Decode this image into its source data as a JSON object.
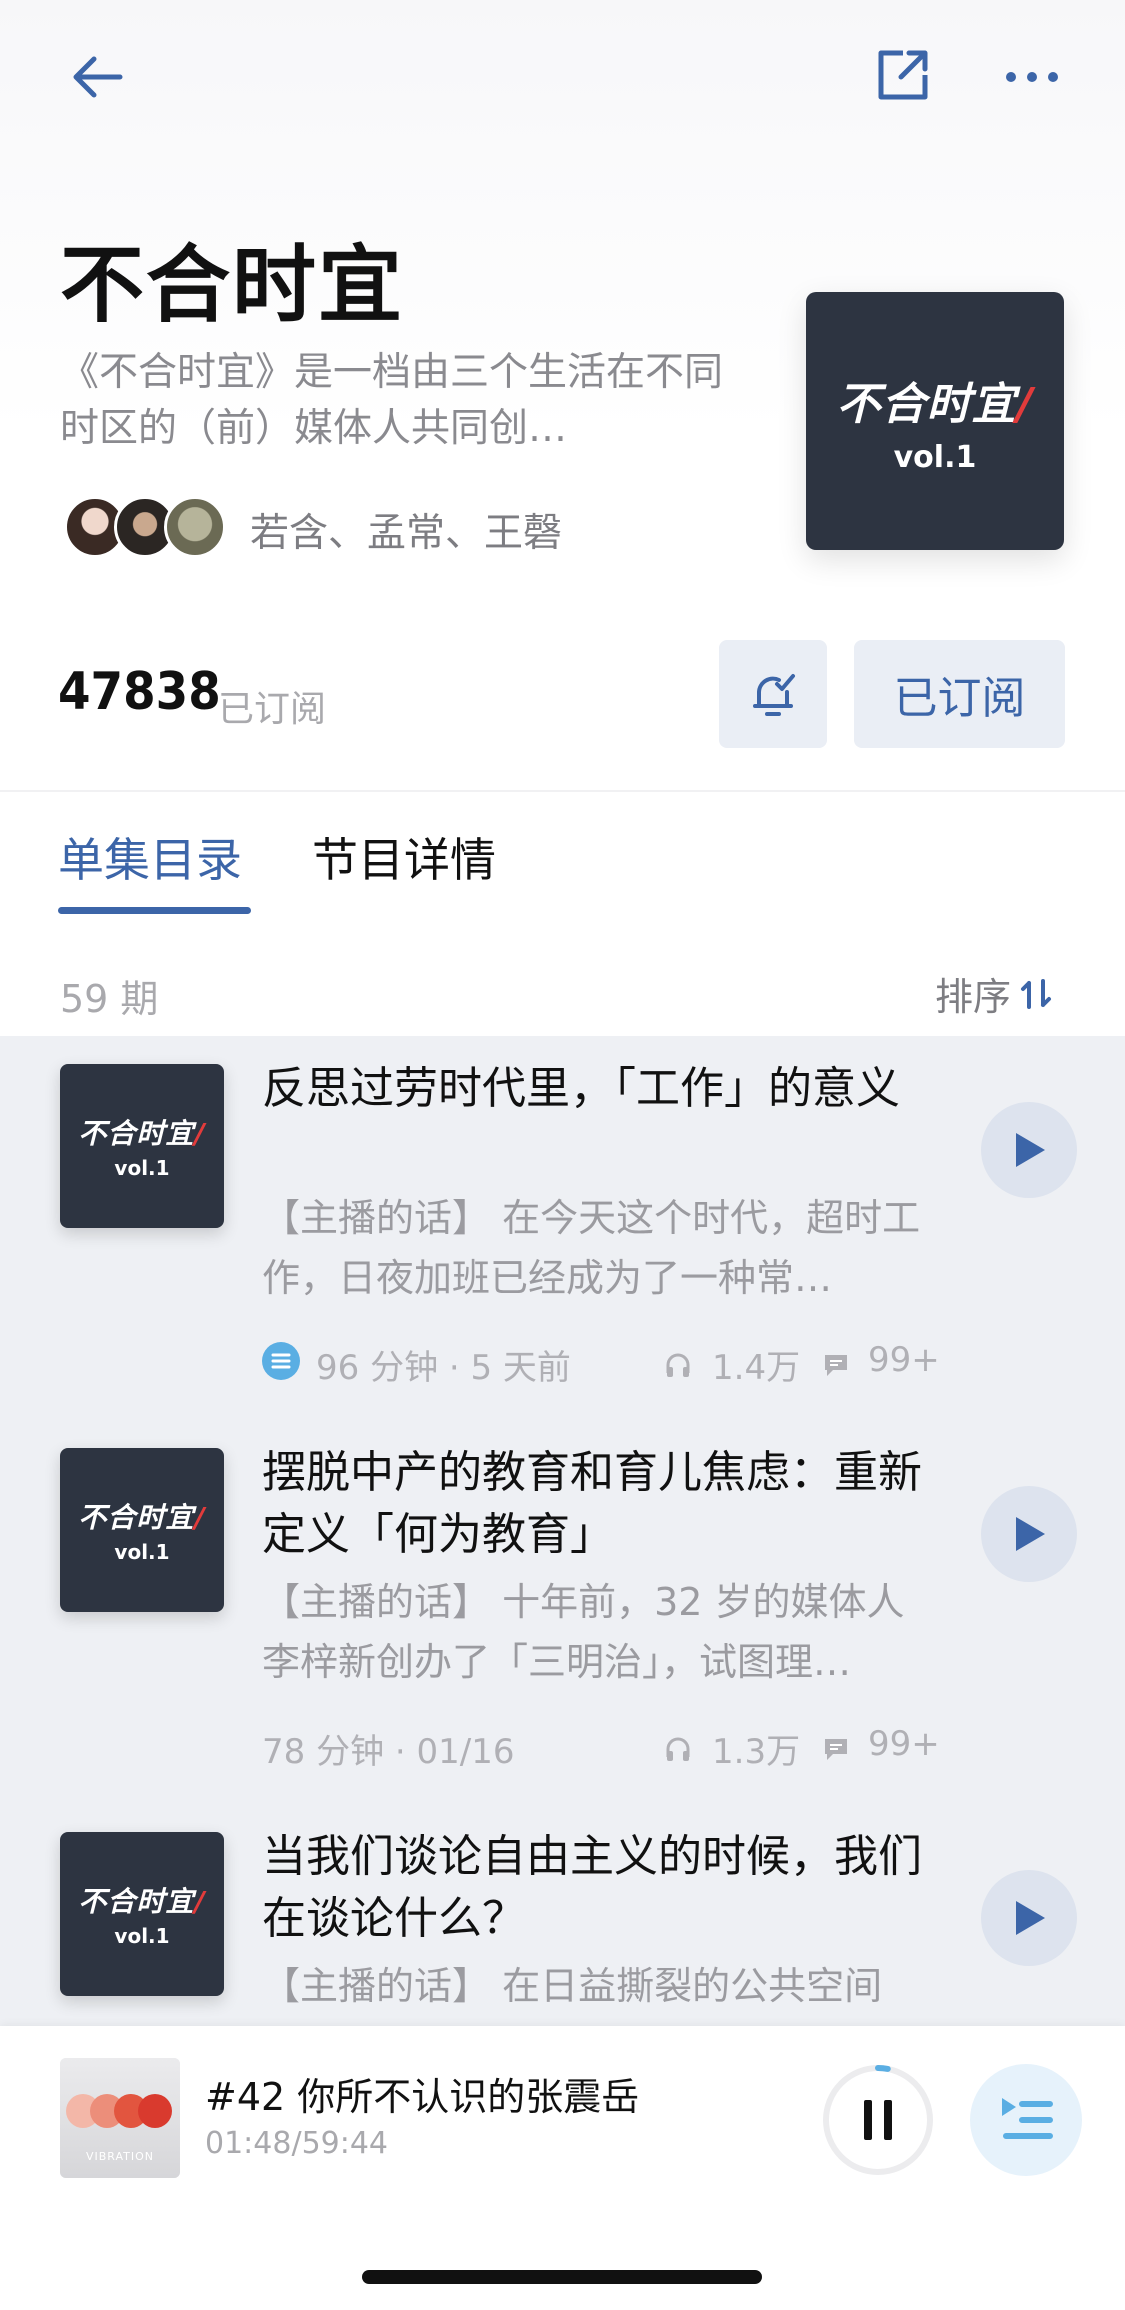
{
  "header": {
    "title": "不合时宜",
    "description": "《不合时宜》是一档由三个生活在不同时区的（前）媒体人共同创…",
    "hosts": "若含、孟常、王磬",
    "subscriber_count": "47838",
    "subscriber_label": "已订阅",
    "subscribe_button": "已订阅",
    "cover_logo": "不合时宜",
    "cover_vol": "vol.1",
    "icons": [
      "back-arrow-icon",
      "share-icon",
      "more-icon",
      "bell-icon"
    ]
  },
  "tabs": [
    {
      "label": "单集目录",
      "active": true
    },
    {
      "label": "节目详情",
      "active": false
    }
  ],
  "list_header": {
    "count": "59 期",
    "sort_label": "排序"
  },
  "episodes": [
    {
      "title": "反思过劳时代里，「工作」的意义",
      "desc": "【主播的话】 在今天这个时代，超时工作，日夜加班已经成为了一种常…",
      "duration": "96 分钟 · 5 天前",
      "plays": "1.4万",
      "comments": "99+",
      "has_transcript": true
    },
    {
      "title": "摆脱中产的教育和育儿焦虑：重新定义「何为教育」",
      "desc": "【主播的话】 十年前，32 岁的媒体人李梓新创办了「三明治」，试图理…",
      "duration": "78 分钟 · 01/16",
      "plays": "1.3万",
      "comments": "99+",
      "has_transcript": false
    },
    {
      "title": "当我们谈论自由主义的时候，我们在谈论什么？",
      "desc": "【主播的话】 在日益撕裂的公共空间",
      "duration": "",
      "plays": "",
      "comments": "",
      "has_transcript": false
    }
  ],
  "player": {
    "title": "#42 你所不认识的张震岳",
    "time": "01:48/59:44",
    "cover_text": "VIBRATION",
    "progress": 0.03
  },
  "colors": {
    "accent": "#3c65a8",
    "cover_bg": "#2d3441",
    "list_bg": "#eef0f4"
  }
}
